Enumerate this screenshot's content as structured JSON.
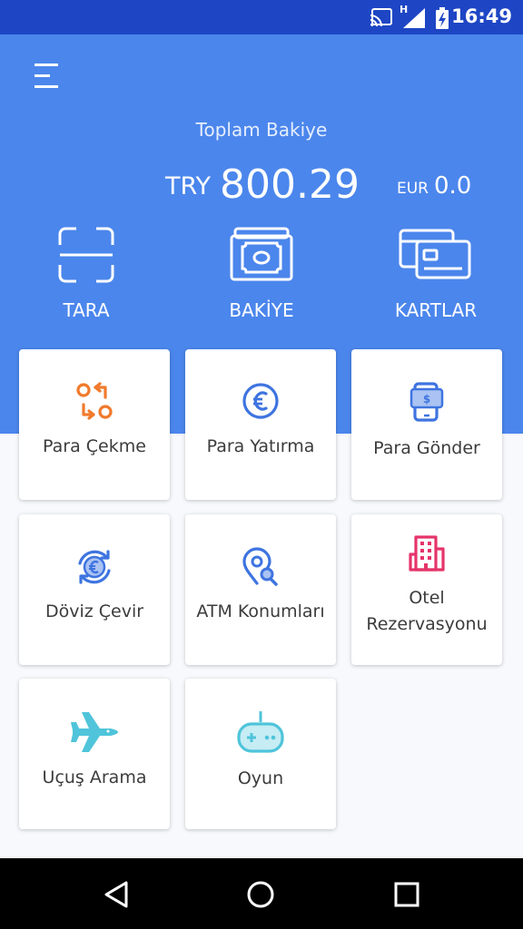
{
  "status_bar": {
    "time": "16:49",
    "network_type": "H"
  },
  "header": {
    "menu_icon": "hamburger-icon",
    "balance_title": "Toplam Bakiye",
    "try_currency": "TRY",
    "try_amount": "800.29",
    "eur_currency": "EUR",
    "eur_amount": "0.0"
  },
  "actions": [
    {
      "label": "TARA",
      "icon": "scan-icon"
    },
    {
      "label": "BAKİYE",
      "icon": "banknote-icon"
    },
    {
      "label": "KARTLAR",
      "icon": "cards-icon"
    }
  ],
  "tiles": [
    {
      "label": "Para Çekme",
      "icon": "exchange-arrows-icon",
      "color": "#f07a2c"
    },
    {
      "label": "Para Yatırma",
      "icon": "euro-coin-icon",
      "color": "#3e74e0"
    },
    {
      "label": "Para Gönder",
      "icon": "phone-money-icon",
      "color": "#3e74e0"
    },
    {
      "label": "Döviz Çevir",
      "icon": "currency-convert-icon",
      "color": "#3e74e0"
    },
    {
      "label": "ATM Konumları",
      "icon": "location-search-icon",
      "color": "#3e74e0"
    },
    {
      "label": "Otel Rezervasyonu",
      "label_line1": "Otel",
      "label_line2": "Rezervasyonu",
      "icon": "hotel-building-icon",
      "color": "#e5346a"
    },
    {
      "label": "Uçuş Arama",
      "icon": "airplane-icon",
      "color": "#4fc4da"
    },
    {
      "label": "Oyun",
      "icon": "gamepad-icon",
      "color": "#4fc4da"
    }
  ],
  "colors": {
    "status_bar": "#1e46c4",
    "header": "#4b86ec",
    "background": "#f7f9fc"
  },
  "nav": {
    "back": "back-icon",
    "home": "home-icon",
    "recents": "recents-icon"
  }
}
